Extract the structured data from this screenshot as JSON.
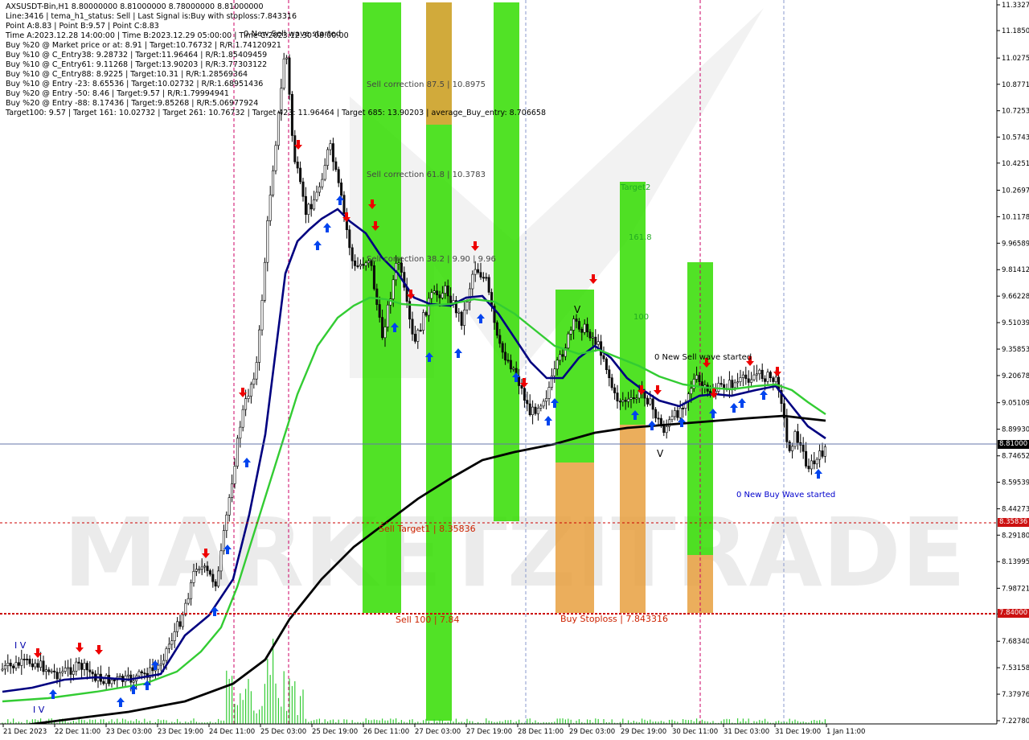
{
  "info_lines": [
    "AXSUSDT-Bin,H1  8.80000000 8.81000000 8.78000000 8.81000000",
    "Line:3416 | tema_h1_status: Sell | Last Signal is:Buy with stoploss:7.843316",
    "Point A:8.83 | Point B:9.57 | Point C:8.83",
    "Time A:2023.12.28 14:00:00 | Time B:2023.12.29 05:00:00 | Time C:2023.12.30 08:00:00",
    "Buy %20 @ Market price or at: 8.91 | Target:10.76732 | R/R:1.74120921",
    "Buy %10 @ C_Entry38: 9.28732 | Target:11.96464 | R/R:1.85409459",
    "Buy %10 @ C_Entry61: 9.11268 | Target:13.90203 | R/R:3.77303122",
    "Buy %10 @ C_Entry88: 8.9225 | Target:10.31 | R/R:1.28569364",
    "Buy %10 @ Entry -23: 8.65536 | Target:10.02732 | R/R:1.68951436",
    "Buy %20 @ Entry -50: 8.46 | Target:9.57 | R/R:1.79994941",
    "Buy %20 @ Entry -88: 8.17436 | Target:9.85268 | R/R:5.06977924",
    "Target100: 9.57 | Target 161: 10.02732 | Target 261: 10.76732 | Target 423: 11.96464 | Target 685: 13.90203 | average_Buy_entry: 8.706658"
  ],
  "price_axis": [
    "11.3327",
    "11.1850",
    "11.0275",
    "10.8771",
    "10.7253",
    "10.5743",
    "10.4251",
    "10.2697",
    "10.1178",
    "9.96589",
    "9.81412",
    "9.66228",
    "9.51039",
    "9.35853",
    "9.20678",
    "9.05109",
    "8.89930",
    "8.74652",
    "8.59539",
    "8.44273",
    "8.29180",
    "8.13995",
    "7.98721",
    "7.84000",
    "7.68340",
    "7.53158",
    "7.37976",
    "7.22780"
  ],
  "time_axis": [
    "21 Dec 2023",
    "22 Dec 11:00",
    "23 Dec 03:00",
    "23 Dec 19:00",
    "24 Dec 11:00",
    "25 Dec 03:00",
    "25 Dec 19:00",
    "26 Dec 11:00",
    "27 Dec 03:00",
    "27 Dec 19:00",
    "28 Dec 11:00",
    "29 Dec 03:00",
    "29 Dec 19:00",
    "30 Dec 11:00",
    "31 Dec 03:00",
    "31 Dec 19:00",
    "1 Jan 11:00"
  ],
  "price_tags": {
    "current": "8.81000",
    "sell_target": "8.35836",
    "stoploss": "7.84000"
  },
  "annotations": {
    "new_sell_wave_top": "0 New Sell wave started",
    "new_sell_wave_mid": "0 New Sell wave started",
    "new_buy_wave": "0 New Buy Wave started",
    "sell_corr_875": "Sell correction 87.5 | 10.8975",
    "sell_corr_618": "Sell correction 61.8 | 10.3783",
    "sell_corr_382": "Sell correction 38.2 | 9.90 | 9.96",
    "sell_target1": "Sell Target1 | 8.35836",
    "sell_100": "Sell 100 | 7.84",
    "buy_stoploss": "Buy Stoploss | 7.843316",
    "target2": "Target2",
    "lvl_1618": "161.8",
    "lvl_100": "100",
    "v_label_1": "V",
    "v_label_2": "V",
    "iv_label": "I V",
    "iv_top": "I V"
  },
  "watermark": "MARKETZITRADE",
  "colors": {
    "green_bar": "#33dd00",
    "orange_bar": "#e8a040",
    "ma_navy": "#000080",
    "ma_green": "#33cc33",
    "ma_black": "#000000",
    "sell_arrow": "#ee0000",
    "buy_arrow": "#0044ee",
    "stop_line": "#cc0000"
  }
}
